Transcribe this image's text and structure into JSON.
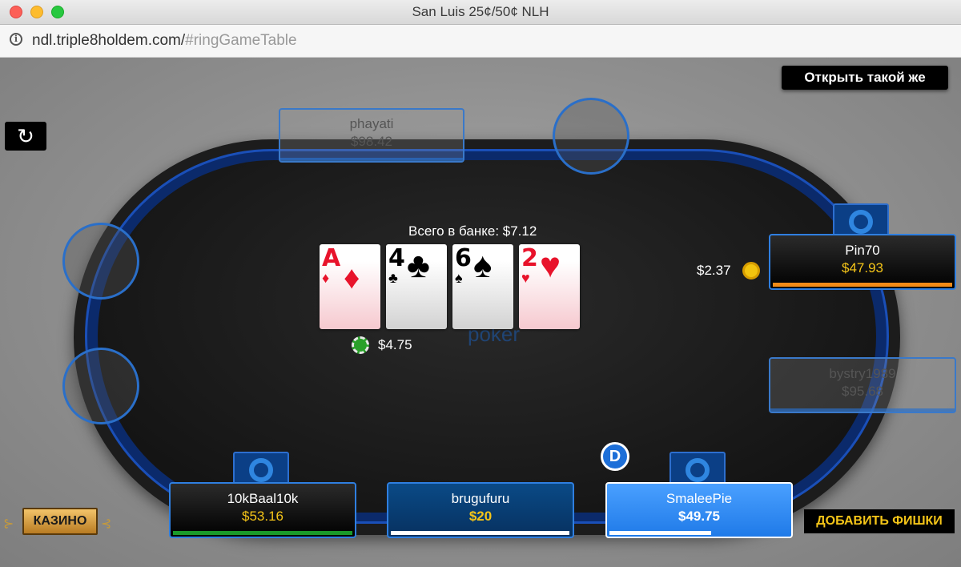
{
  "window": {
    "title": "San Luis 25¢/50¢ NLH"
  },
  "address": {
    "host": "ndl.triple8holdem.com/",
    "path": "#ringGameTable"
  },
  "controls": {
    "open_same": "Открыть такой же",
    "refresh_icon": "↻",
    "casino": "КАЗИНО",
    "add_chips": "ДОБАВИТЬ ФИШКИ"
  },
  "table": {
    "logo": "poker",
    "pot_label": "Всего в банке: $7.12",
    "board": [
      {
        "rank": "A",
        "suit": "♦",
        "color": "red"
      },
      {
        "rank": "4",
        "suit": "♣",
        "color": "black"
      },
      {
        "rank": "6",
        "suit": "♠",
        "color": "black"
      },
      {
        "rank": "2",
        "suit": "♥",
        "color": "red"
      }
    ],
    "pot_chips": "$4.75",
    "dealer_button": "D"
  },
  "seats": {
    "phayati": {
      "name": "phayati",
      "stack": "$98.42",
      "state": "sitting-out"
    },
    "pin70": {
      "name": "Pin70",
      "stack": "$47.93",
      "bet": "$2.37",
      "timer_color": "#f08a16"
    },
    "bystry": {
      "name": "bystry1989",
      "stack": "$95.68",
      "state": "sitting-out"
    },
    "baal": {
      "name": "10kBaal10k",
      "stack": "$53.16",
      "timer_color": "#1a9a2a"
    },
    "brugufuru": {
      "name": "brugufuru",
      "stack": "$20"
    },
    "smalee": {
      "name": "SmaleePie",
      "stack": "$49.75"
    }
  },
  "colors": {
    "accent_blue": "#2f7fe0",
    "gold": "#f5c518"
  }
}
